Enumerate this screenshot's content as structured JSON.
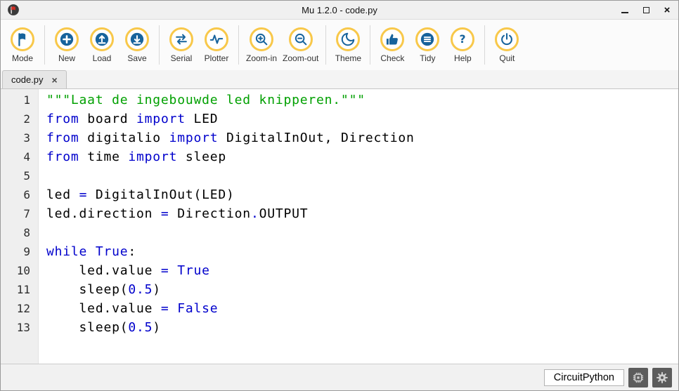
{
  "window": {
    "title": "Mu 1.2.0 - code.py",
    "controls": {
      "close_glyph": "×"
    }
  },
  "toolbar": {
    "groups": [
      {
        "items": [
          {
            "id": "mode",
            "label": "Mode",
            "icon": "mode-icon"
          }
        ]
      },
      {
        "items": [
          {
            "id": "new",
            "label": "New",
            "icon": "new-icon"
          },
          {
            "id": "load",
            "label": "Load",
            "icon": "load-icon"
          },
          {
            "id": "save",
            "label": "Save",
            "icon": "save-icon"
          }
        ]
      },
      {
        "items": [
          {
            "id": "serial",
            "label": "Serial",
            "icon": "serial-icon"
          },
          {
            "id": "plotter",
            "label": "Plotter",
            "icon": "plotter-icon"
          }
        ]
      },
      {
        "items": [
          {
            "id": "zoom-in",
            "label": "Zoom-in",
            "icon": "zoom-in-icon"
          },
          {
            "id": "zoom-out",
            "label": "Zoom-out",
            "icon": "zoom-out-icon"
          }
        ]
      },
      {
        "items": [
          {
            "id": "theme",
            "label": "Theme",
            "icon": "theme-icon"
          }
        ]
      },
      {
        "items": [
          {
            "id": "check",
            "label": "Check",
            "icon": "check-icon"
          },
          {
            "id": "tidy",
            "label": "Tidy",
            "icon": "tidy-icon"
          },
          {
            "id": "help",
            "label": "Help",
            "icon": "help-icon"
          }
        ]
      },
      {
        "items": [
          {
            "id": "quit",
            "label": "Quit",
            "icon": "quit-icon"
          }
        ]
      }
    ]
  },
  "tabbar": {
    "active_tab": {
      "label": "code.py",
      "close_glyph": "×"
    }
  },
  "editor": {
    "lines": [
      {
        "num": "1",
        "segments": [
          [
            "s",
            "\"\"\"Laat de ingebouwde led knipperen.\"\"\""
          ]
        ]
      },
      {
        "num": "2",
        "segments": [
          [
            "k",
            "from"
          ],
          [
            "d",
            " board "
          ],
          [
            "k",
            "import"
          ],
          [
            "d",
            " LED"
          ]
        ]
      },
      {
        "num": "3",
        "segments": [
          [
            "k",
            "from"
          ],
          [
            "d",
            " digitalio "
          ],
          [
            "k",
            "import"
          ],
          [
            "d",
            " DigitalInOut, Direction"
          ]
        ]
      },
      {
        "num": "4",
        "segments": [
          [
            "k",
            "from"
          ],
          [
            "d",
            " time "
          ],
          [
            "k",
            "import"
          ],
          [
            "d",
            " sleep"
          ]
        ]
      },
      {
        "num": "5",
        "segments": []
      },
      {
        "num": "6",
        "segments": [
          [
            "d",
            "led "
          ],
          [
            "o",
            "="
          ],
          [
            "d",
            " DigitalInOut(LED)"
          ]
        ]
      },
      {
        "num": "7",
        "segments": [
          [
            "d",
            "led.direction "
          ],
          [
            "o",
            "="
          ],
          [
            "d",
            " Direction"
          ],
          [
            "o",
            "."
          ],
          [
            "d",
            "OUTPUT"
          ]
        ]
      },
      {
        "num": "8",
        "segments": []
      },
      {
        "num": "9",
        "segments": [
          [
            "k",
            "while"
          ],
          [
            "d",
            " "
          ],
          [
            "k",
            "True"
          ],
          [
            "d",
            ":"
          ]
        ]
      },
      {
        "num": "10",
        "segments": [
          [
            "d",
            "    led.value "
          ],
          [
            "o",
            "="
          ],
          [
            "d",
            " "
          ],
          [
            "k",
            "True"
          ]
        ]
      },
      {
        "num": "11",
        "segments": [
          [
            "d",
            "    sleep("
          ],
          [
            "n",
            "0.5"
          ],
          [
            "d",
            ")"
          ]
        ]
      },
      {
        "num": "12",
        "segments": [
          [
            "d",
            "    led.value "
          ],
          [
            "o",
            "="
          ],
          [
            "d",
            " "
          ],
          [
            "k",
            "False"
          ]
        ]
      },
      {
        "num": "13",
        "segments": [
          [
            "d",
            "    sleep("
          ],
          [
            "n",
            "0.5"
          ],
          [
            "d",
            ")"
          ]
        ]
      }
    ]
  },
  "statusbar": {
    "mode_label": "CircuitPython",
    "buttons": [
      {
        "icon": "microchip-icon"
      },
      {
        "icon": "gear-icon"
      }
    ]
  },
  "colors": {
    "toolbar_ring": "#f8c84a",
    "icon_blue": "#17639c",
    "keyword": "#0000cc",
    "string": "#00a000",
    "number": "#0000cc",
    "operator": "#0000cc",
    "code_text": "#000000"
  }
}
